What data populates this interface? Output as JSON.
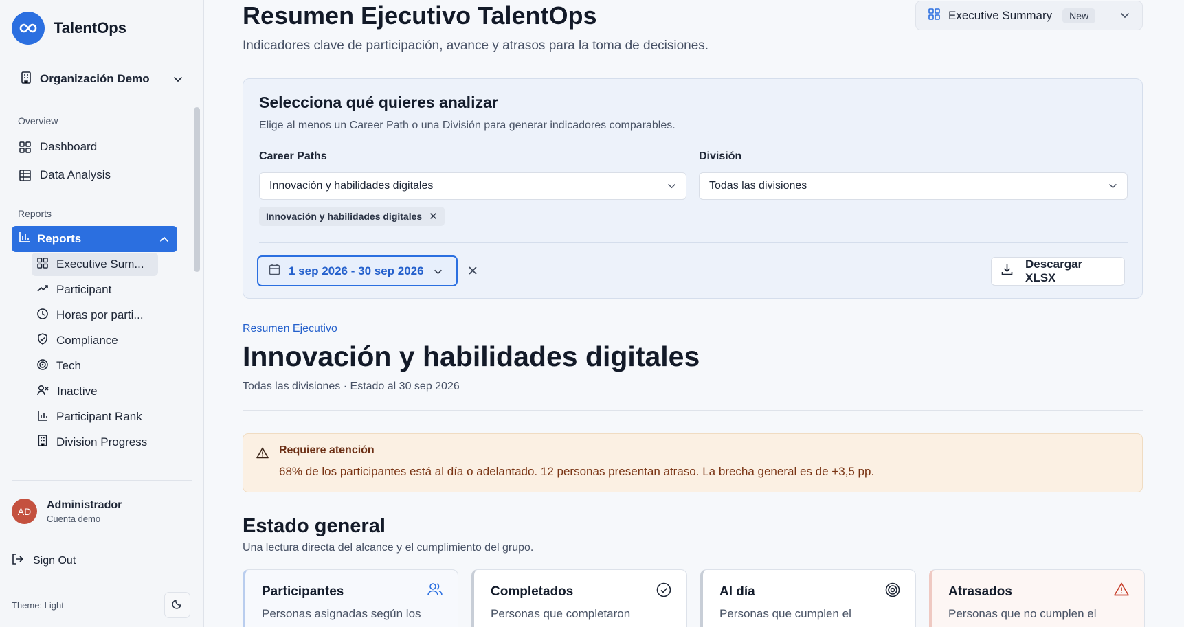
{
  "brand": {
    "name": "TalentOps"
  },
  "org": {
    "label": "Organización Demo"
  },
  "sidebar": {
    "overview_label": "Overview",
    "overview_items": [
      {
        "label": "Dashboard",
        "icon": "grid-icon"
      },
      {
        "label": "Data Analysis",
        "icon": "table-icon"
      }
    ],
    "reports_section_label": "Reports",
    "reports_label": "Reports",
    "report_items": [
      {
        "label": "Executive Sum...",
        "icon": "grid-icon",
        "selected": true
      },
      {
        "label": "Participant",
        "icon": "trend-up-icon"
      },
      {
        "label": "Horas por parti...",
        "icon": "clock-icon"
      },
      {
        "label": "Compliance",
        "icon": "shield-check-icon"
      },
      {
        "label": "Tech",
        "icon": "target-icon"
      },
      {
        "label": "Inactive",
        "icon": "user-x-icon"
      },
      {
        "label": "Participant Rank",
        "icon": "bar-chart-icon"
      },
      {
        "label": "Division Progress",
        "icon": "building-icon"
      }
    ],
    "user": {
      "initials": "AD",
      "name": "Administrador",
      "sub": "Cuenta demo"
    },
    "sign_out": "Sign Out",
    "theme": "Theme: Light"
  },
  "header": {
    "title": "Resumen Ejecutivo TalentOps",
    "subtitle": "Indicadores clave de participación, avance y atrasos para la toma de decisiones.",
    "view_select": {
      "label": "Executive Summary",
      "badge": "New"
    }
  },
  "filters": {
    "title": "Selecciona qué quieres analizar",
    "subtitle": "Elige al menos un Career Path o una División para generar indicadores comparables.",
    "career_label": "Career Paths",
    "career_value": "Innovación y habilidades digitales",
    "division_label": "División",
    "division_value": "Todas las divisiones",
    "chip": "Innovación y habilidades digitales",
    "date_range": "1 sep 2026 - 30 sep 2026",
    "download": "Descargar XLSX"
  },
  "summary": {
    "eyebrow": "Resumen Ejecutivo",
    "title": "Innovación y habilidades digitales",
    "meta": "Todas las divisiones · Estado al 30 sep 2026"
  },
  "alert": {
    "title": "Requiere atención",
    "text": "68% de los participantes está al día o adelantado. 12 personas presentan atraso. La brecha general es de +3,5 pp."
  },
  "status": {
    "title": "Estado general",
    "subtitle": "Una lectura directa del alcance y el cumplimiento del grupo.",
    "cards": [
      {
        "title": "Participantes",
        "desc": "Personas asignadas según los",
        "icon": "users-icon"
      },
      {
        "title": "Completados",
        "desc": "Personas que completaron",
        "icon": "check-circle-icon"
      },
      {
        "title": "Al día",
        "desc": "Personas que cumplen el",
        "icon": "target-icon"
      },
      {
        "title": "Atrasados",
        "desc": "Personas que no cumplen el",
        "icon": "warning-icon"
      }
    ]
  },
  "colors": {
    "accent": "#2b6fe0",
    "alert_bg": "#fbf0e3",
    "avatar": "#c4513f"
  }
}
